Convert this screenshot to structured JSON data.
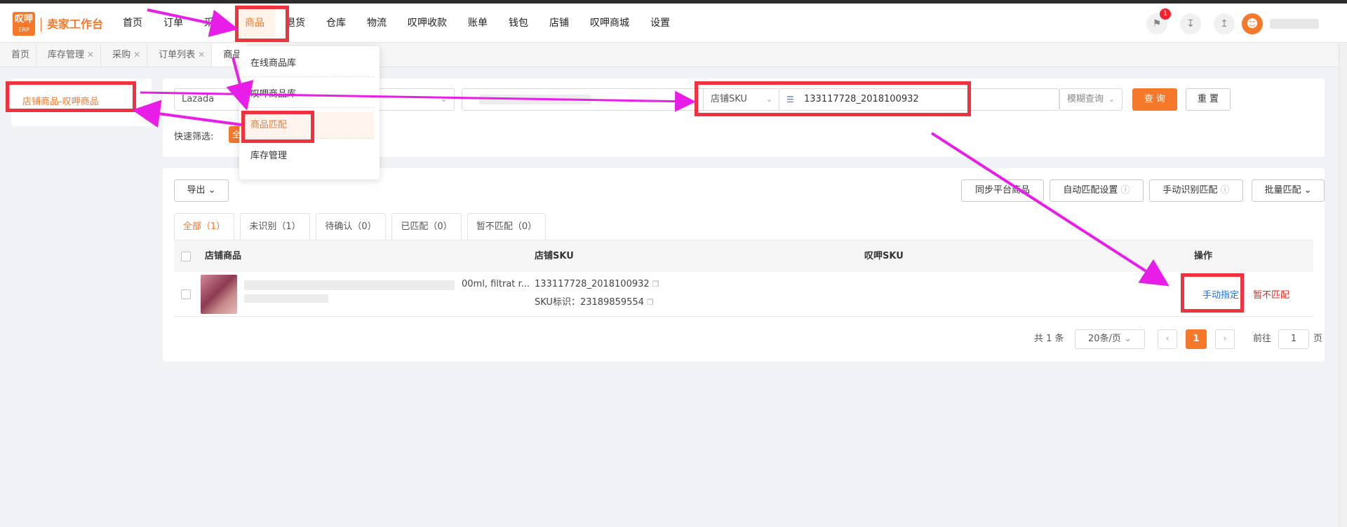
{
  "colors": {
    "accent": "#f5782b",
    "annotation_box": "#f2313f",
    "annotation_arrow": "#e81ee8",
    "link": "#1e6fde",
    "danger": "#e0281e"
  },
  "logo": {
    "line1": "叹呷",
    "line2": "ERP",
    "brand": "卖家工作台"
  },
  "nav": [
    "首页",
    "订单",
    "采购",
    "商品",
    "退货",
    "仓库",
    "物流",
    "叹呷收款",
    "账单",
    "钱包",
    "店铺",
    "叹呷商城",
    "设置"
  ],
  "top_icons": [
    {
      "icon": "megaphone-icon",
      "badge": "1"
    },
    {
      "icon": "download-icon"
    },
    {
      "icon": "share-icon"
    }
  ],
  "page_tabs": [
    {
      "label": "首页",
      "closable": false
    },
    {
      "label": "库存管理",
      "closable": true
    },
    {
      "label": "采购",
      "closable": true
    },
    {
      "label": "订单列表",
      "closable": true
    },
    {
      "label": "商品",
      "closable": false
    }
  ],
  "dropdown": [
    "在线商品库",
    "叹呷商品库",
    "商品匹配",
    "库存管理"
  ],
  "sidebar": {
    "item": "店铺商品-叹呷商品"
  },
  "filters": {
    "platform": "Lazada",
    "sku_field": "店铺SKU",
    "sku_value": "133117728_2018100932",
    "match_mode": "模糊查询",
    "query_btn": "查 询",
    "reset_btn": "重 置",
    "quick_label": "快速筛选:",
    "quick_tag": "全"
  },
  "actions": {
    "export": "导出",
    "sync": "同步平台商品",
    "auto_match": "自动匹配设置",
    "manual_identify": "手动识别匹配",
    "batch_match": "批量匹配"
  },
  "filter_tabs": [
    "全部（1）",
    "未识别（1）",
    "待确认（0）",
    "已匹配（0）",
    "暂不匹配（0）"
  ],
  "table": {
    "headers": {
      "product": "店铺商品",
      "shop_sku": "店铺SKU",
      "erp_sku": "叹呷SKU",
      "ops": "操作"
    },
    "rows": [
      {
        "name_tail": "00ml, filtrat r...",
        "shop_sku": "133117728_2018100932",
        "sku_id_label": "SKU标识：23189859554",
        "op_manual": "手动指定",
        "op_skip": "暂不匹配"
      }
    ]
  },
  "pagination": {
    "total": "共 1 条",
    "page_size": "20条/页",
    "current": "1",
    "goto_label": "前往",
    "goto_value": "1",
    "page_unit": "页"
  }
}
